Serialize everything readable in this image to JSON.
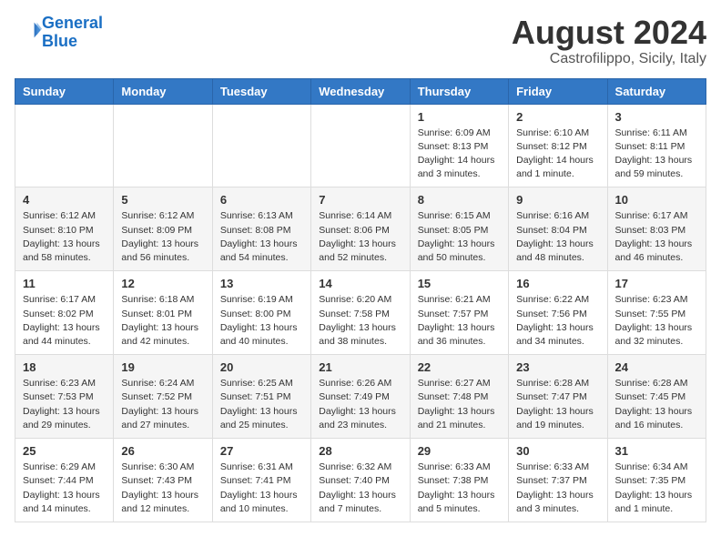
{
  "header": {
    "logo_line1": "General",
    "logo_line2": "Blue",
    "month_year": "August 2024",
    "location": "Castrofilippo, Sicily, Italy"
  },
  "days_of_week": [
    "Sunday",
    "Monday",
    "Tuesday",
    "Wednesday",
    "Thursday",
    "Friday",
    "Saturday"
  ],
  "weeks": [
    [
      {
        "day": "",
        "info": ""
      },
      {
        "day": "",
        "info": ""
      },
      {
        "day": "",
        "info": ""
      },
      {
        "day": "",
        "info": ""
      },
      {
        "day": "1",
        "info": "Sunrise: 6:09 AM\nSunset: 8:13 PM\nDaylight: 14 hours\nand 3 minutes."
      },
      {
        "day": "2",
        "info": "Sunrise: 6:10 AM\nSunset: 8:12 PM\nDaylight: 14 hours\nand 1 minute."
      },
      {
        "day": "3",
        "info": "Sunrise: 6:11 AM\nSunset: 8:11 PM\nDaylight: 13 hours\nand 59 minutes."
      }
    ],
    [
      {
        "day": "4",
        "info": "Sunrise: 6:12 AM\nSunset: 8:10 PM\nDaylight: 13 hours\nand 58 minutes."
      },
      {
        "day": "5",
        "info": "Sunrise: 6:12 AM\nSunset: 8:09 PM\nDaylight: 13 hours\nand 56 minutes."
      },
      {
        "day": "6",
        "info": "Sunrise: 6:13 AM\nSunset: 8:08 PM\nDaylight: 13 hours\nand 54 minutes."
      },
      {
        "day": "7",
        "info": "Sunrise: 6:14 AM\nSunset: 8:06 PM\nDaylight: 13 hours\nand 52 minutes."
      },
      {
        "day": "8",
        "info": "Sunrise: 6:15 AM\nSunset: 8:05 PM\nDaylight: 13 hours\nand 50 minutes."
      },
      {
        "day": "9",
        "info": "Sunrise: 6:16 AM\nSunset: 8:04 PM\nDaylight: 13 hours\nand 48 minutes."
      },
      {
        "day": "10",
        "info": "Sunrise: 6:17 AM\nSunset: 8:03 PM\nDaylight: 13 hours\nand 46 minutes."
      }
    ],
    [
      {
        "day": "11",
        "info": "Sunrise: 6:17 AM\nSunset: 8:02 PM\nDaylight: 13 hours\nand 44 minutes."
      },
      {
        "day": "12",
        "info": "Sunrise: 6:18 AM\nSunset: 8:01 PM\nDaylight: 13 hours\nand 42 minutes."
      },
      {
        "day": "13",
        "info": "Sunrise: 6:19 AM\nSunset: 8:00 PM\nDaylight: 13 hours\nand 40 minutes."
      },
      {
        "day": "14",
        "info": "Sunrise: 6:20 AM\nSunset: 7:58 PM\nDaylight: 13 hours\nand 38 minutes."
      },
      {
        "day": "15",
        "info": "Sunrise: 6:21 AM\nSunset: 7:57 PM\nDaylight: 13 hours\nand 36 minutes."
      },
      {
        "day": "16",
        "info": "Sunrise: 6:22 AM\nSunset: 7:56 PM\nDaylight: 13 hours\nand 34 minutes."
      },
      {
        "day": "17",
        "info": "Sunrise: 6:23 AM\nSunset: 7:55 PM\nDaylight: 13 hours\nand 32 minutes."
      }
    ],
    [
      {
        "day": "18",
        "info": "Sunrise: 6:23 AM\nSunset: 7:53 PM\nDaylight: 13 hours\nand 29 minutes."
      },
      {
        "day": "19",
        "info": "Sunrise: 6:24 AM\nSunset: 7:52 PM\nDaylight: 13 hours\nand 27 minutes."
      },
      {
        "day": "20",
        "info": "Sunrise: 6:25 AM\nSunset: 7:51 PM\nDaylight: 13 hours\nand 25 minutes."
      },
      {
        "day": "21",
        "info": "Sunrise: 6:26 AM\nSunset: 7:49 PM\nDaylight: 13 hours\nand 23 minutes."
      },
      {
        "day": "22",
        "info": "Sunrise: 6:27 AM\nSunset: 7:48 PM\nDaylight: 13 hours\nand 21 minutes."
      },
      {
        "day": "23",
        "info": "Sunrise: 6:28 AM\nSunset: 7:47 PM\nDaylight: 13 hours\nand 19 minutes."
      },
      {
        "day": "24",
        "info": "Sunrise: 6:28 AM\nSunset: 7:45 PM\nDaylight: 13 hours\nand 16 minutes."
      }
    ],
    [
      {
        "day": "25",
        "info": "Sunrise: 6:29 AM\nSunset: 7:44 PM\nDaylight: 13 hours\nand 14 minutes."
      },
      {
        "day": "26",
        "info": "Sunrise: 6:30 AM\nSunset: 7:43 PM\nDaylight: 13 hours\nand 12 minutes."
      },
      {
        "day": "27",
        "info": "Sunrise: 6:31 AM\nSunset: 7:41 PM\nDaylight: 13 hours\nand 10 minutes."
      },
      {
        "day": "28",
        "info": "Sunrise: 6:32 AM\nSunset: 7:40 PM\nDaylight: 13 hours\nand 7 minutes."
      },
      {
        "day": "29",
        "info": "Sunrise: 6:33 AM\nSunset: 7:38 PM\nDaylight: 13 hours\nand 5 minutes."
      },
      {
        "day": "30",
        "info": "Sunrise: 6:33 AM\nSunset: 7:37 PM\nDaylight: 13 hours\nand 3 minutes."
      },
      {
        "day": "31",
        "info": "Sunrise: 6:34 AM\nSunset: 7:35 PM\nDaylight: 13 hours\nand 1 minute."
      }
    ]
  ]
}
